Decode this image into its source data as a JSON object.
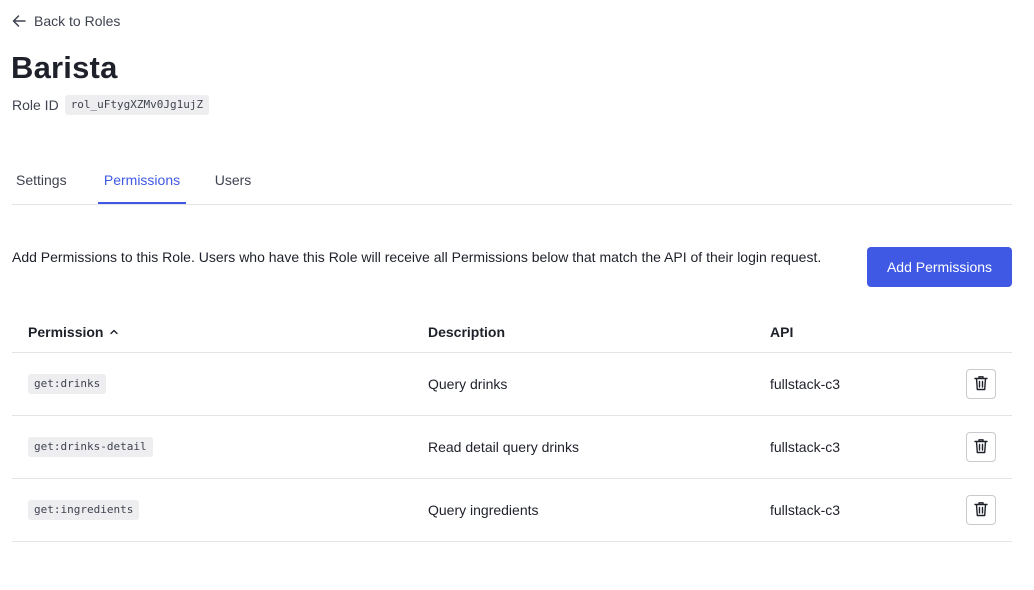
{
  "nav": {
    "back_label": "Back to Roles"
  },
  "role": {
    "name": "Barista",
    "id_label": "Role ID",
    "id_value": "rol_uFtygXZMv0Jg1ujZ"
  },
  "tabs": [
    {
      "label": "Settings",
      "active": false
    },
    {
      "label": "Permissions",
      "active": true
    },
    {
      "label": "Users",
      "active": false
    }
  ],
  "permissions_panel": {
    "description": "Add Permissions to this Role. Users who have this Role will receive all Permissions below that match the API of their login request.",
    "add_button_label": "Add Permissions"
  },
  "table": {
    "columns": [
      "Permission",
      "Description",
      "API"
    ],
    "sort_column": "Permission",
    "sort_direction": "ascending",
    "rows": [
      {
        "permission": "get:drinks",
        "description": "Query drinks",
        "api": "fullstack-c3"
      },
      {
        "permission": "get:drinks-detail",
        "description": "Read detail query drinks",
        "api": "fullstack-c3"
      },
      {
        "permission": "get:ingredients",
        "description": "Query ingredients",
        "api": "fullstack-c3"
      }
    ]
  },
  "icons": {
    "back": "arrow-left-icon",
    "sort": "chevron-up-icon",
    "delete": "trash-icon"
  },
  "colors": {
    "accent": "#3f59e4",
    "text": "#1e212a",
    "muted": "#3f4350",
    "border": "#e3e4e8"
  }
}
